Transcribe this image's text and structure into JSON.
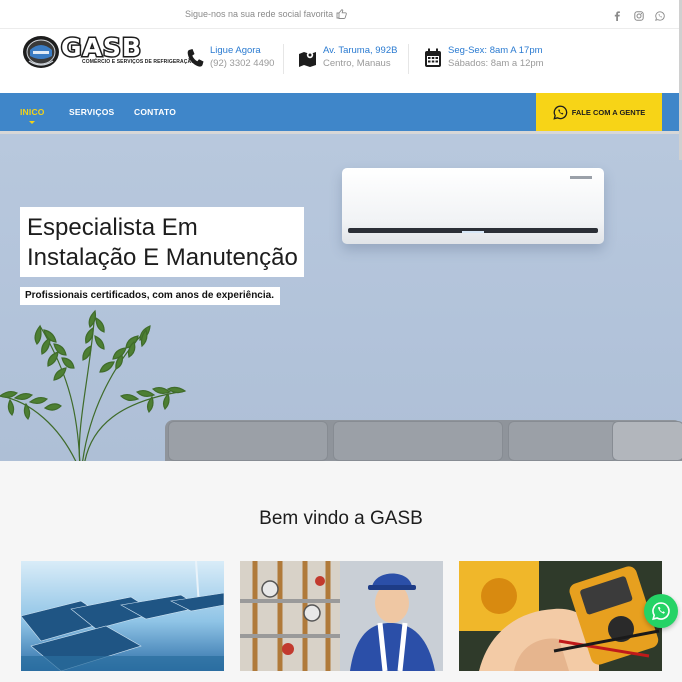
{
  "topbar": {
    "follow_text": "Sigue-nos na sua rede social favorita",
    "social": [
      "facebook-icon",
      "instagram-icon",
      "whatsapp-icon"
    ]
  },
  "logo": {
    "name": "GASB",
    "subtitle": "COMÉRCIO E SERVIÇOS DE REFRIGERAÇÃO"
  },
  "contact": [
    {
      "icon": "phone-icon",
      "title": "Ligue Agora",
      "detail": "(92) 3302 4490"
    },
    {
      "icon": "map-icon",
      "title": "Av. Taruma, 992B",
      "detail": "Centro, Manaus"
    },
    {
      "icon": "calendar-icon",
      "title": "Seg-Sex: 8am A 17pm",
      "detail": "Sábados: 8am a 12pm"
    }
  ],
  "nav": {
    "items": [
      "INICO",
      "SERVIÇOS",
      "CONTATO"
    ],
    "active": "INICO",
    "cta_label": "FALE COM A GENTE"
  },
  "hero": {
    "title_line1": "Especialista Em",
    "title_line2": "Instalação E Manutenção",
    "subtitle": "Profissionais certificados, com anos de experiência."
  },
  "welcome": {
    "title": "Bem vindo a GASB"
  },
  "colors": {
    "nav_bg": "#3f86c9",
    "cta_bg": "#f7d417",
    "accent_blue": "#2b7bd1",
    "active_nav": "#f2d21a",
    "whatsapp": "#25d366"
  }
}
